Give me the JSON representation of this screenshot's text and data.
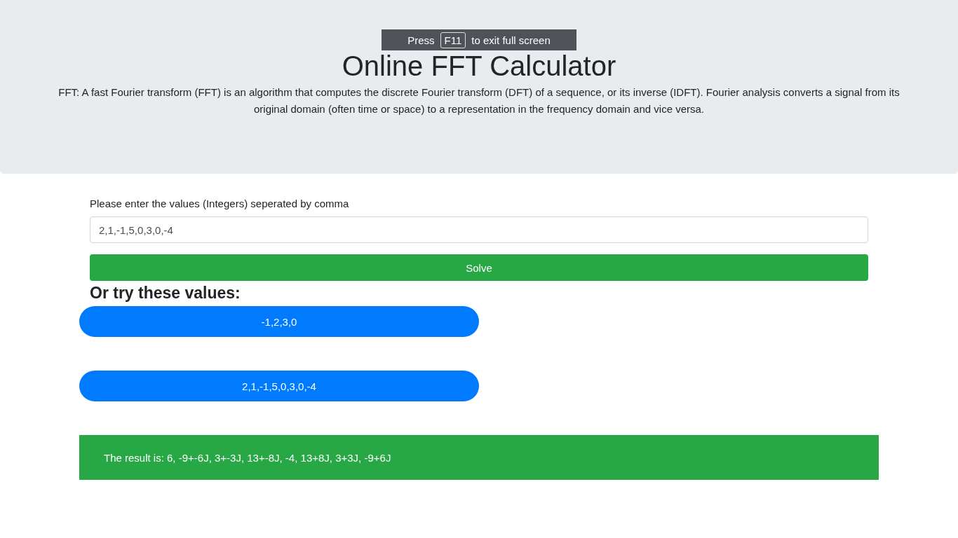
{
  "fullscreen_notice": {
    "before": "Press",
    "key": "F11",
    "after": "to exit full screen"
  },
  "header": {
    "title": "Online FFT Calculator",
    "description": "FFT: A fast Fourier transform (FFT) is an algorithm that computes the discrete Fourier transform (DFT) of a sequence, or its inverse (IDFT). Fourier analysis converts a signal from its original domain (often time or space) to a representation in the frequency domain and vice versa."
  },
  "form": {
    "label": "Please enter the values (Integers) seperated by comma",
    "value": "2,1,-1,5,0,3,0,-4",
    "button": "Solve"
  },
  "examples": {
    "heading": "Or try these values:",
    "buttons": [
      "-1,2,3,0",
      "2,1,-1,5,0,3,0,-4"
    ]
  },
  "result": "The result is: 6, -9+-6J, 3+-3J, 13+-8J, -4, 13+8J, 3+3J, -9+6J"
}
